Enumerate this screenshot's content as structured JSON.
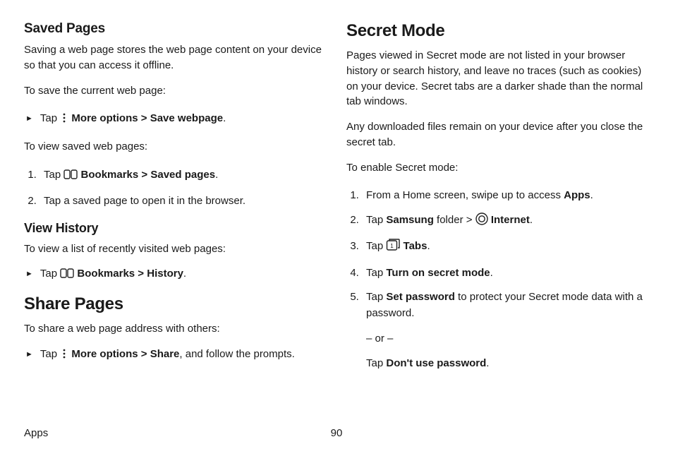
{
  "left": {
    "h_saved": "Saved Pages",
    "saved_intro": "Saving a web page stores the web page content on your device so that you can access it offline.",
    "save_lead": "To save the current web page:",
    "save_step_prefix": "Tap ",
    "more_options": "More options",
    "sep": " > ",
    "save_webpage": "Save webpage",
    "period": ".",
    "view_saved_lead": "To view saved web pages:",
    "vs1_prefix": "Tap ",
    "bookmarks": "Bookmarks",
    "saved_pages": "Saved pages",
    "vs2": "Tap a saved page to open it in the browser.",
    "h_viewhist": "View History",
    "vh_lead": "To view a list of recently visited web pages:",
    "vh_step_prefix": "Tap ",
    "history": "History",
    "h_share": "Share Pages",
    "share_lead": "To share a web page address with others:",
    "share_prefix": "Tap ",
    "share": "Share",
    "share_suffix": ", and follow the prompts."
  },
  "right": {
    "h_secret": "Secret Mode",
    "secret_p1": "Pages viewed in Secret mode are not listed in your browser history or search history, and leave no traces (such as cookies) on your device. Secret tabs are a darker shade than the normal tab windows.",
    "secret_p2": "Any downloaded files remain on your device after you close the secret tab.",
    "enable_lead": "To enable Secret mode:",
    "s1_a": "From a Home screen, swipe up to access ",
    "apps": "Apps",
    "s2_a": "Tap ",
    "samsung": "Samsung",
    "s2_b": " folder > ",
    "internet": "Internet",
    "s3_a": "Tap ",
    "tabs": "Tabs",
    "s4_a": "Tap ",
    "turn_on": "Turn on secret mode",
    "s5_a": "Tap ",
    "set_pw": "Set password",
    "s5_b": " to protect your Secret mode data with a password.",
    "or": "– or –",
    "s5_c": "Tap ",
    "dont_use": "Don't use password"
  },
  "footer": {
    "section": "Apps",
    "page": "90"
  },
  "icons": {
    "more": "more-options-icon",
    "bookmarks": "bookmarks-icon",
    "internet": "internet-icon",
    "tabs": "tabs-icon"
  }
}
